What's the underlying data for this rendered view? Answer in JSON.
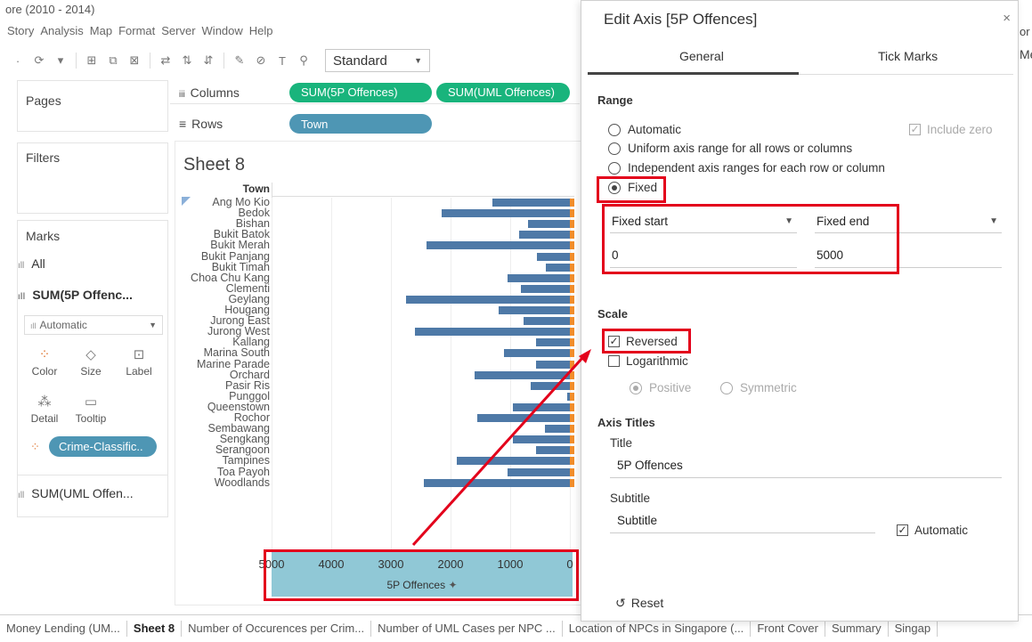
{
  "window": {
    "title": "ore (2010 - 2014)"
  },
  "menubar": [
    "Story",
    "Analysis",
    "Map",
    "Format",
    "Server",
    "Window",
    "Help"
  ],
  "toolbar": {
    "fit_value": "Standard"
  },
  "shelves": {
    "pages_label": "Pages",
    "filters_label": "Filters",
    "columns_label": "Columns",
    "rows_label": "Rows",
    "columns_pills": [
      "SUM(5P Offences)",
      "SUM(UML Offences)"
    ],
    "rows_pill": "Town"
  },
  "marks": {
    "title": "Marks",
    "all_label": "All",
    "sum5p_label": "SUM(5P Offenc...",
    "type_value": "Automatic",
    "buttons": [
      "Color",
      "Size",
      "Label",
      "Detail",
      "Tooltip"
    ],
    "crime_pill": "Crime-Classific..",
    "sumuml_label": "SUM(UML Offen..."
  },
  "sheet": {
    "title": "Sheet 8",
    "row_header": "Town"
  },
  "chart_data": {
    "type": "bar",
    "orientation": "horizontal",
    "categories": [
      "Ang Mo Kio",
      "Bedok",
      "Bishan",
      "Bukit Batok",
      "Bukit Merah",
      "Bukit Panjang",
      "Bukit Timah",
      "Choa Chu Kang",
      "Clementi",
      "Geylang",
      "Hougang",
      "Jurong East",
      "Jurong West",
      "Kallang",
      "Marina South",
      "Marine Parade",
      "Orchard",
      "Pasir Ris",
      "Punggol",
      "Queenstown",
      "Rochor",
      "Sembawang",
      "Sengkang",
      "Serangoon",
      "Tampines",
      "Toa Payoh",
      "Woodlands"
    ],
    "series": [
      {
        "values": [
          1300,
          2150,
          700,
          850,
          2400,
          550,
          400,
          1050,
          820,
          2750,
          1200,
          780,
          2600,
          560,
          1100,
          570,
          1600,
          650,
          50,
          950,
          1550,
          420,
          950,
          560,
          1900,
          1050,
          2450
        ],
        "color": "#4e79a7"
      },
      {
        "values": [
          250,
          250,
          250,
          250,
          250,
          250,
          250,
          250,
          250,
          250,
          250,
          250,
          250,
          250,
          250,
          250,
          250,
          250,
          250,
          250,
          250,
          250,
          250,
          250,
          250,
          250,
          250
        ],
        "color": "#f28e2b"
      }
    ],
    "xlim": [
      0,
      5000
    ],
    "x_reversed": true,
    "ticks": [
      "5000",
      "4000",
      "3000",
      "2000",
      "1000",
      "0"
    ],
    "xlabel": "5P Offences"
  },
  "bottom_tabs": [
    "Money Lending (UM...",
    "Sheet 8",
    "Number of Occurences per Crim...",
    "Number of UML Cases per NPC ...",
    "Location of NPCs in Singapore (...",
    "Front Cover",
    "Summary",
    "Singap"
  ],
  "dialog": {
    "title": "Edit Axis [5P Offences]",
    "close_glyph": "×",
    "tab_general": "General",
    "tab_ticks": "Tick Marks",
    "range_title": "Range",
    "range_options": [
      "Automatic",
      "Uniform axis range for all rows or columns",
      "Independent axis ranges for each row or column",
      "Fixed"
    ],
    "include_zero": "Include zero",
    "fixed_start_label": "Fixed start",
    "fixed_end_label": "Fixed end",
    "fixed_start_value": "0",
    "fixed_end_value": "5000",
    "scale_title": "Scale",
    "reversed": "Reversed",
    "logarithmic": "Logarithmic",
    "positive": "Positive",
    "symmetric": "Symmetric",
    "axis_titles_title": "Axis Titles",
    "title_label": "Title",
    "title_value": "5P Offences",
    "subtitle_label": "Subtitle",
    "subtitle_placeholder": "Subtitle",
    "automatic": "Automatic",
    "reset": "Reset"
  },
  "colors": {
    "highlight": "#e3001b",
    "accent_green": "#19b47c",
    "accent_blue": "#4e96b4"
  }
}
